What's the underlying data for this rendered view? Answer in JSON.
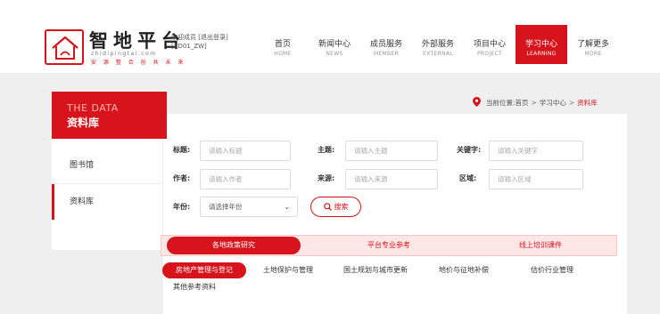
{
  "header": {
    "brand_title": "智地平台",
    "brand_domain": "zhidipingtai.com",
    "brand_slogan": "安 源 整 合 创 共 未 来",
    "welcome_text": "欢迎成员 [退出登录]",
    "user_id": "[ZD01_ZW]"
  },
  "nav": [
    {
      "cn": "首页",
      "en": "HOME",
      "active": false
    },
    {
      "cn": "新闻中心",
      "en": "NEWS",
      "active": false
    },
    {
      "cn": "成员服务",
      "en": "MEMBER",
      "active": false
    },
    {
      "cn": "外部服务",
      "en": "EXTERNAL",
      "active": false
    },
    {
      "cn": "项目中心",
      "en": "PROJECT",
      "active": false
    },
    {
      "cn": "学习中心",
      "en": "LEARNING",
      "active": true
    },
    {
      "cn": "了解更多",
      "en": "MORE",
      "active": false
    }
  ],
  "sidebar": {
    "head_en": "THE DATA",
    "head_cn": "资料库",
    "items": [
      "图书馆",
      "资料库"
    ]
  },
  "breadcrumb": {
    "prefix": "当前位置:",
    "items": [
      "首页",
      "学习中心",
      "资料库"
    ]
  },
  "form": {
    "title_label": "标题:",
    "title_placeholder": "请输入标题",
    "theme_label": "主题:",
    "theme_placeholder": "请输入主题",
    "keyword_label": "关键字:",
    "keyword_placeholder": "请输入关键字",
    "author_label": "作者:",
    "author_placeholder": "请输入作者",
    "source_label": "来源:",
    "source_placeholder": "请输入来源",
    "region_label": "区域:",
    "region_placeholder": "请输入区域",
    "year_label": "年份:",
    "year_selected": "请选择年份",
    "search_label": "搜索"
  },
  "category_tabs": [
    "各地政策研究",
    "平台专业参考",
    "线上培训课件"
  ],
  "sub_tabs": [
    "房地产管理与登记",
    "土地保护与管理",
    "国土规划与城市更新",
    "地价与征地补偿",
    "估价行业管理"
  ],
  "sub_other": "其他参考资料",
  "colors": {
    "accent": "#d7141c",
    "band": "#efefef",
    "tab_bg": "#fde6e6"
  }
}
